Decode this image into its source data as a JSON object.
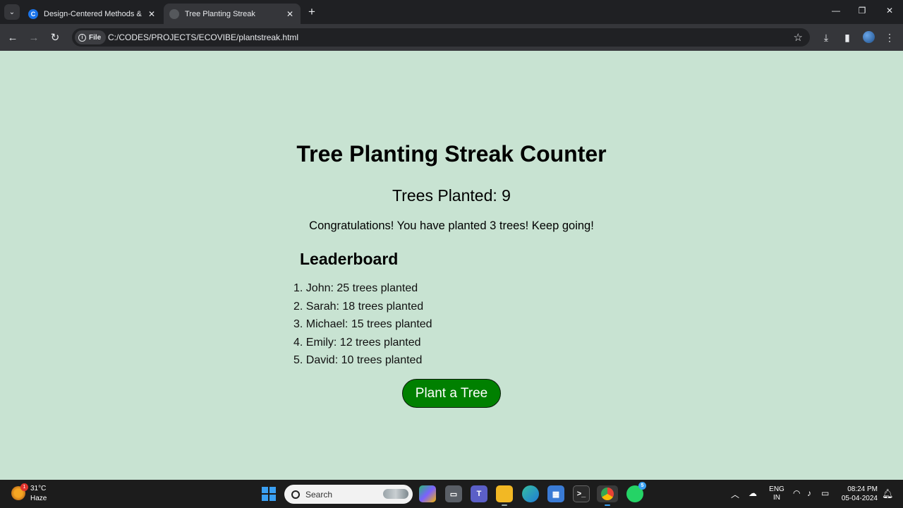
{
  "browser": {
    "tabs": [
      {
        "favicon": "C",
        "title": "Design-Centered Methods & W",
        "active": false
      },
      {
        "favicon": "",
        "title": "Tree Planting Streak",
        "active": true
      }
    ],
    "site_chip": "File",
    "url": "C:/CODES/PROJECTS/ECOVIBE/plantstreak.html"
  },
  "page": {
    "heading": "Tree Planting Streak Counter",
    "trees_planted": "Trees Planted: 9",
    "message": "Congratulations! You have planted 3 trees! Keep going!",
    "leaderboard_title": "Leaderboard",
    "leaderboard": [
      "1. John: 25 trees planted",
      "2. Sarah: 18 trees planted",
      "3. Michael: 15 trees planted",
      "4. Emily: 12 trees planted",
      "5. David: 10 trees planted"
    ],
    "button_label": "Plant a Tree",
    "colors": {
      "background": "#c8e3d2",
      "button": "#008000"
    }
  },
  "taskbar": {
    "weather_badge": "1",
    "temperature": "31°C",
    "condition": "Haze",
    "search_placeholder": "Search",
    "whatsapp_badge": "5",
    "lang_line1": "ENG",
    "lang_line2": "IN",
    "time": "08:24 PM",
    "date": "05-04-2024"
  }
}
